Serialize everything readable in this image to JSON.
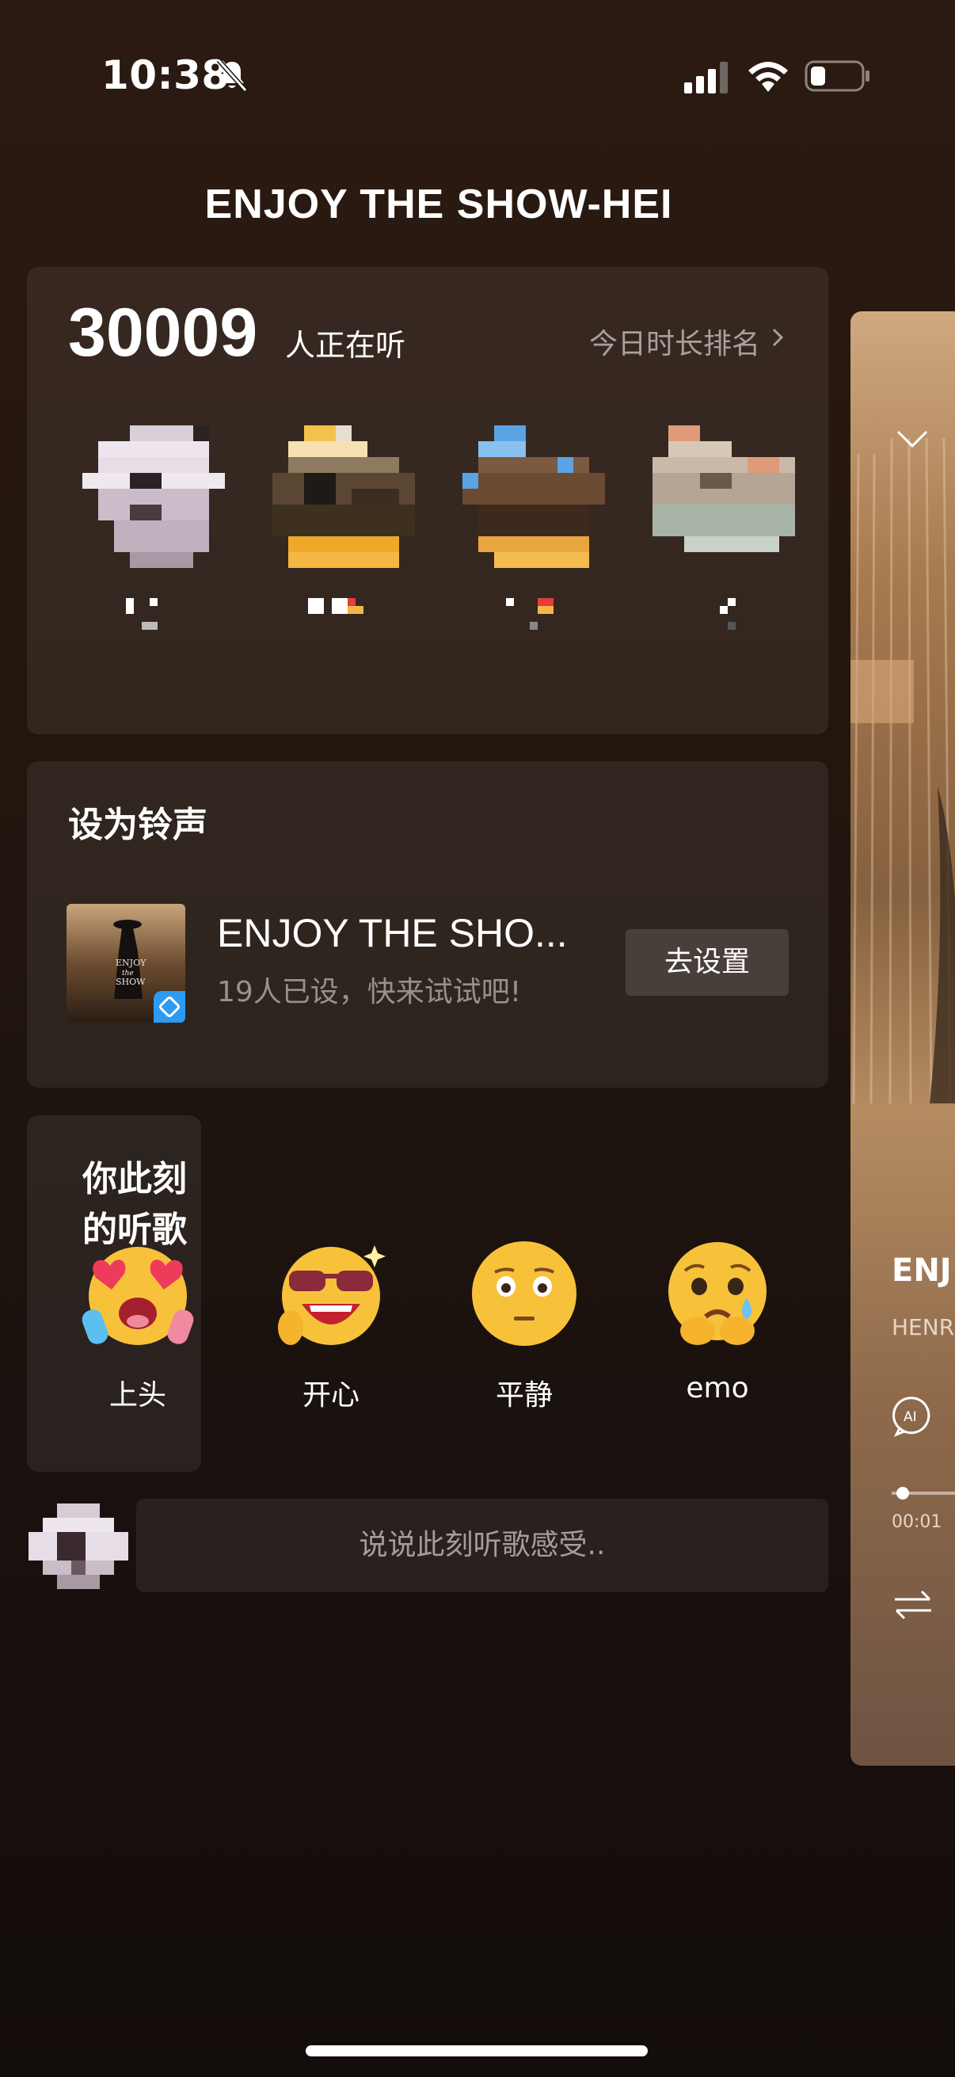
{
  "status_bar": {
    "time": "10:38"
  },
  "header": {
    "title": "ENJOY THE SHOW-HEI"
  },
  "listeners": {
    "count": "30009",
    "count_suffix": "人正在听",
    "ranking_link": "今日时长排名",
    "items": [
      {
        "colors": [
          "#e8e2ea",
          "#cbbfcc",
          "#3a2a2f"
        ]
      },
      {
        "colors": [
          "#f0b443",
          "#5a3a22",
          "#26201c"
        ]
      },
      {
        "colors": [
          "#6aa7e0",
          "#6b4a32",
          "#f0b443"
        ]
      },
      {
        "colors": [
          "#d8c8b8",
          "#a8b4a8",
          "#e09a7a"
        ]
      }
    ]
  },
  "ringtone": {
    "title": "设为铃声",
    "song": "ENJOY THE SHO...",
    "subtitle": "19人已设，快来试试吧!",
    "button": "去设置",
    "cover_text": [
      "ENJOY",
      "the",
      "SHOW"
    ]
  },
  "mood": {
    "title": "你此刻的听歌心情?",
    "options": [
      {
        "label": "上头",
        "icon": "heart-eyes-emoji"
      },
      {
        "label": "开心",
        "icon": "sunglasses-emoji"
      },
      {
        "label": "平静",
        "icon": "calm-emoji"
      },
      {
        "label": "emo",
        "icon": "sad-emoji"
      }
    ]
  },
  "comment": {
    "placeholder": "说说此刻听歌感受.."
  },
  "side_card": {
    "title": "ENJ",
    "artist": "HENR",
    "time": "00:01"
  },
  "colors": {
    "background": "#24170f",
    "card": "rgba(255,255,255,0.07)",
    "accent_badge": "#2b9bf4"
  }
}
